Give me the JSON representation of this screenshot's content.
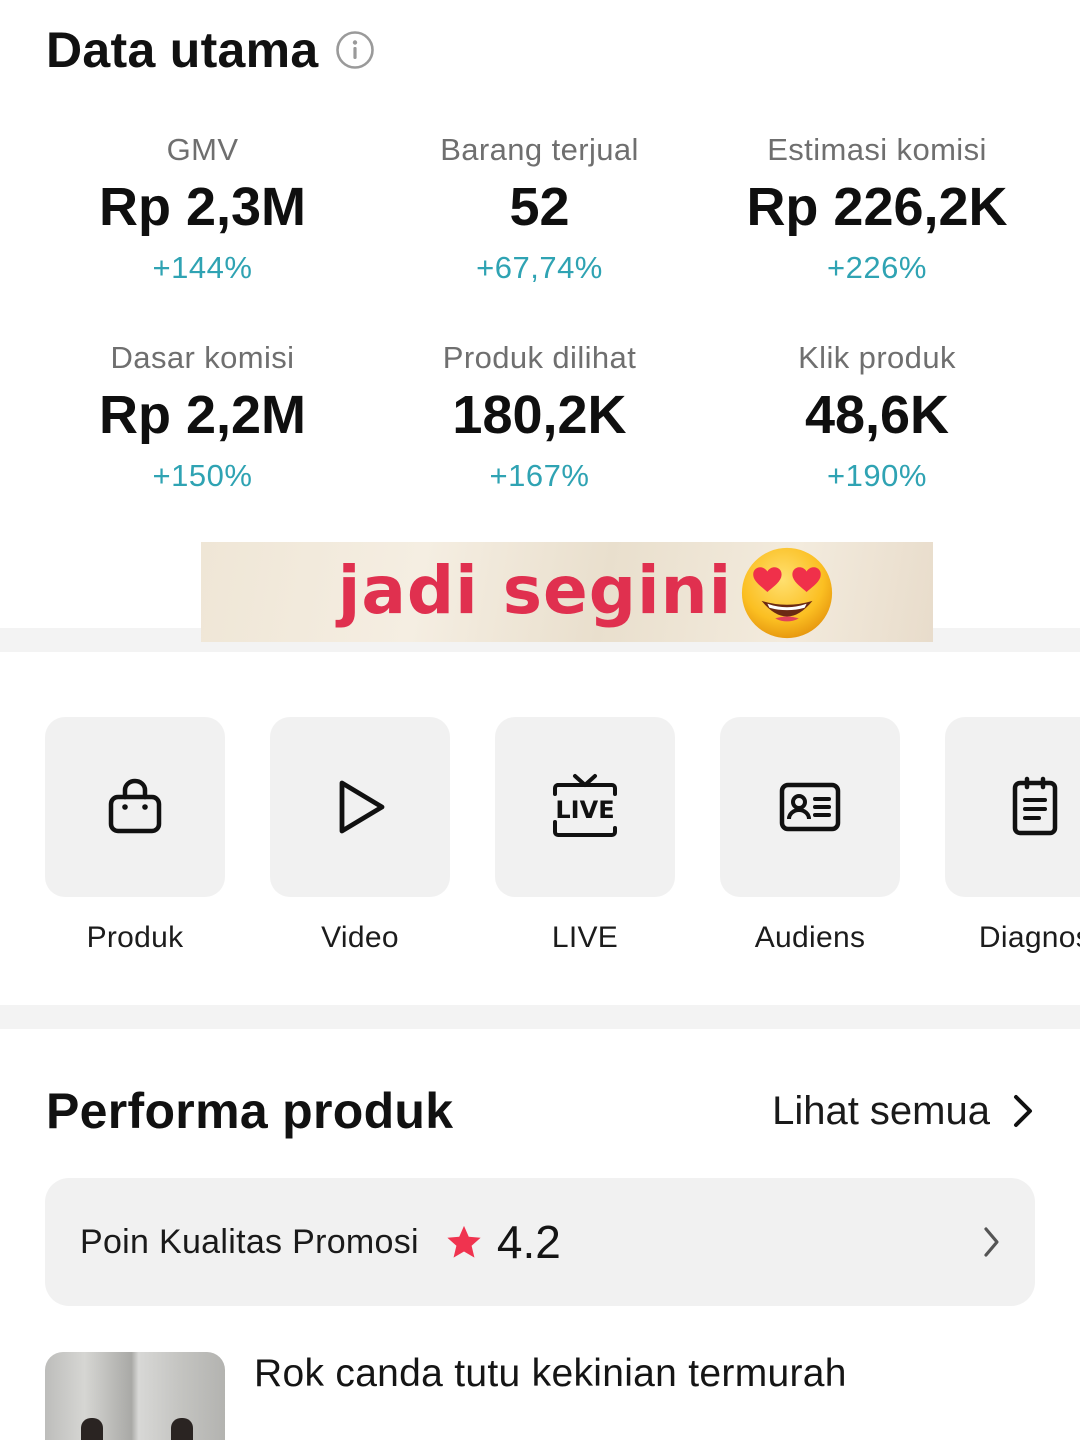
{
  "header": {
    "title": "Data utama",
    "info_icon": "info-icon"
  },
  "metrics": [
    {
      "label": "GMV",
      "value": "Rp 2,3M",
      "change": "+144%"
    },
    {
      "label": "Barang terjual",
      "value": "52",
      "change": "+67,74%"
    },
    {
      "label": "Estimasi komisi",
      "value": "Rp 226,2K",
      "change": "+226%"
    },
    {
      "label": "Dasar komisi",
      "value": "Rp 2,2M",
      "change": "+150%"
    },
    {
      "label": "Produk dilihat",
      "value": "180,2K",
      "change": "+167%"
    },
    {
      "label": "Klik produk",
      "value": "48,6K",
      "change": "+190%"
    }
  ],
  "sticker": {
    "text": "jadi segini",
    "emoji": "heart-eyes-emoji"
  },
  "tiles": [
    {
      "label": "Produk",
      "icon": "shopping-bag-icon"
    },
    {
      "label": "Video",
      "icon": "play-icon"
    },
    {
      "label": "LIVE",
      "icon": "live-tv-icon"
    },
    {
      "label": "Audiens",
      "icon": "id-card-icon"
    },
    {
      "label": "Diagnos",
      "icon": "clipboard-icon"
    }
  ],
  "performa": {
    "title": "Performa produk",
    "see_all": "Lihat semua",
    "promo_label": "Poin Kualitas Promosi",
    "promo_score": "4.2",
    "product_title": "Rok canda tutu kekinian termurah"
  },
  "colors": {
    "positive": "#2fa3b3",
    "star": "#f0334f",
    "tile_bg": "#f1f1f1"
  }
}
